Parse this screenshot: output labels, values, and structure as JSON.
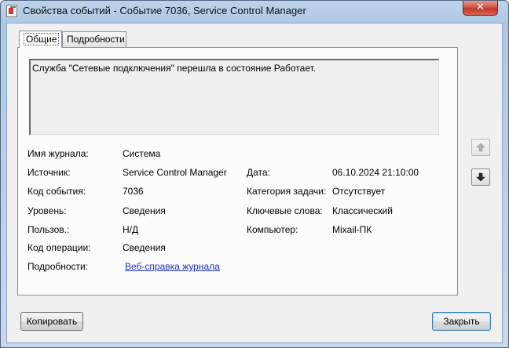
{
  "window": {
    "title": "Свойства событий - Событие 7036, Service Control Manager",
    "close_glyph": "✕"
  },
  "tabs": [
    {
      "label": "Общие",
      "active": true
    },
    {
      "label": "Подробности",
      "active": false
    }
  ],
  "message": "Служба \"Сетевые подключения\" перешла в состояние Работает.",
  "fields": {
    "log_name": {
      "label": "Имя журнала:",
      "value": "Система"
    },
    "source": {
      "label": "Источник:",
      "value": "Service Control Manager"
    },
    "date": {
      "label": "Дата:",
      "value": "06.10.2024 21:10:00"
    },
    "event_id": {
      "label": "Код события:",
      "value": "7036"
    },
    "task_category": {
      "label": "Категория задачи:",
      "value": "Отсутствует"
    },
    "level": {
      "label": "Уровень:",
      "value": "Сведения"
    },
    "keywords": {
      "label": "Ключевые слова:",
      "value": "Классический"
    },
    "user": {
      "label": "Пользов.:",
      "value": "Н/Д"
    },
    "computer": {
      "label": "Компьютер:",
      "value": "Mixail-ПК"
    },
    "opcode": {
      "label": "Код операции:",
      "value": "Сведения"
    },
    "more_info": {
      "label": "Подробности:",
      "value": "Веб-справка журнала "
    }
  },
  "buttons": {
    "copy": "Копировать",
    "close": "Закрыть"
  },
  "icons": {
    "up": "arrow-up-icon",
    "down": "arrow-down-icon"
  }
}
